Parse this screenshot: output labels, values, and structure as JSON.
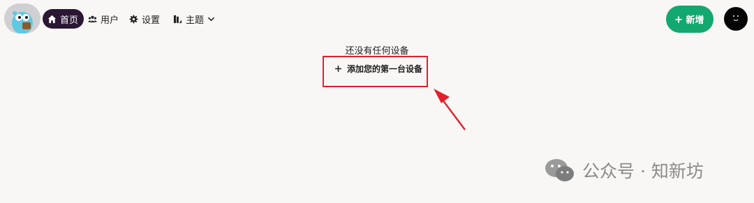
{
  "nav": {
    "home_label": "首页",
    "users_label": "用户",
    "settings_label": "设置",
    "theme_label": "主题"
  },
  "header": {
    "new_button_label": "新增"
  },
  "main": {
    "empty_message": "还没有任何设备",
    "add_first_device_label": "添加您的第一台设备"
  },
  "watermark": {
    "text": "公众号 · 知新坊"
  },
  "colors": {
    "active_nav_bg": "#2b1733",
    "new_button_bg": "#13a86f",
    "highlight_red": "#e2202c",
    "page_bg": "#f9f7f5"
  }
}
